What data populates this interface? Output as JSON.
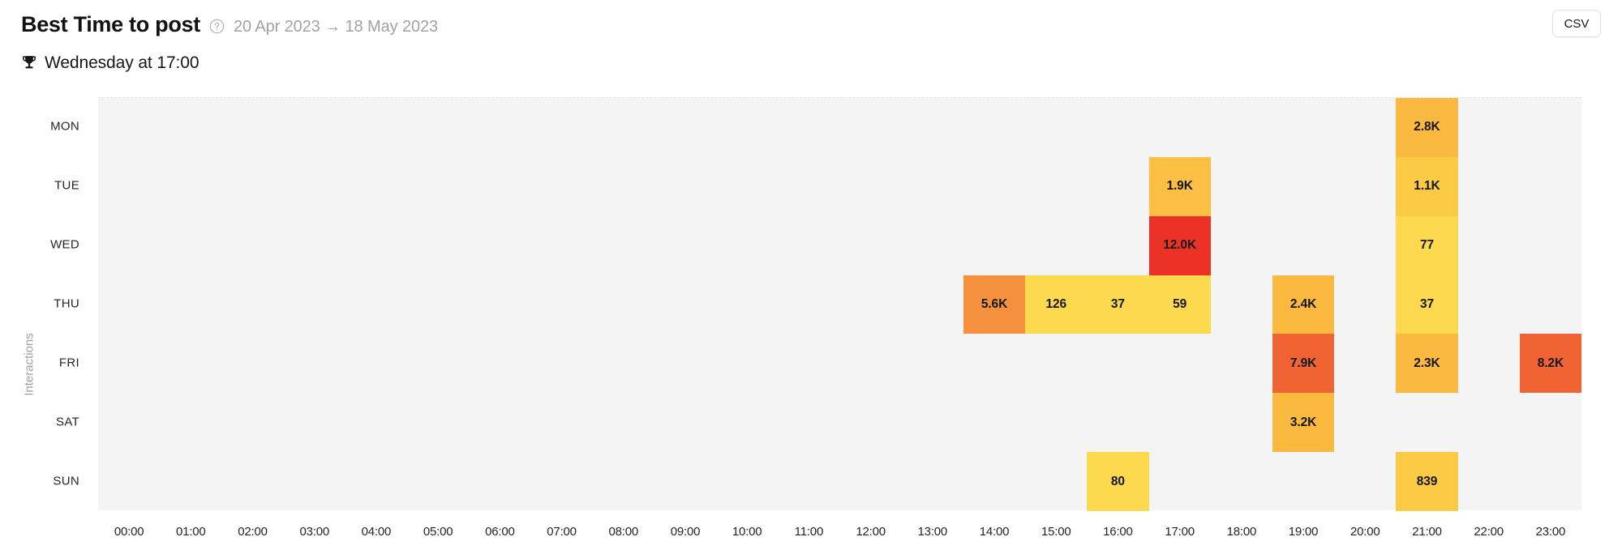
{
  "header": {
    "title": "Best Time to post",
    "help_icon": "help-circle-icon",
    "date_range": "20 Apr 2023 → 18 May 2023",
    "csv_label": "CSV"
  },
  "subtitle": {
    "trophy_icon": "trophy-icon",
    "text": "Wednesday at 17:00"
  },
  "chart_data": {
    "type": "heatmap",
    "title": "Best Time to post",
    "xlabel": "",
    "ylabel": "Interactions",
    "grid": false,
    "legend": "none",
    "x_tick_labels": [
      "00:00",
      "01:00",
      "02:00",
      "03:00",
      "04:00",
      "05:00",
      "06:00",
      "07:00",
      "08:00",
      "09:00",
      "10:00",
      "11:00",
      "12:00",
      "13:00",
      "14:00",
      "15:00",
      "16:00",
      "17:00",
      "18:00",
      "19:00",
      "20:00",
      "21:00",
      "22:00",
      "23:00"
    ],
    "y_tick_labels": [
      "MON",
      "TUE",
      "WED",
      "THU",
      "FRI",
      "SAT",
      "SUN"
    ],
    "colors": {
      "empty": "#f4f4f5",
      "pale_yellow": "#fcd94e",
      "yellow": "#fbcb46",
      "amber": "#fbb940",
      "orange": "#f4903e",
      "deep_orange": "#f06434",
      "red": "#ec3126"
    },
    "cells": [
      {
        "day": "MON",
        "hour": "21:00",
        "label": "2.8K",
        "value": 2800,
        "color": "#fbb940"
      },
      {
        "day": "TUE",
        "hour": "17:00",
        "label": "1.9K",
        "value": 1900,
        "color": "#fbbf44"
      },
      {
        "day": "TUE",
        "hour": "21:00",
        "label": "1.1K",
        "value": 1100,
        "color": "#fbcb46"
      },
      {
        "day": "WED",
        "hour": "17:00",
        "label": "12.0K",
        "value": 12000,
        "color": "#ec3126"
      },
      {
        "day": "WED",
        "hour": "21:00",
        "label": "77",
        "value": 77,
        "color": "#fcd94e"
      },
      {
        "day": "THU",
        "hour": "14:00",
        "label": "5.6K",
        "value": 5600,
        "color": "#f4903e"
      },
      {
        "day": "THU",
        "hour": "15:00",
        "label": "126",
        "value": 126,
        "color": "#fcd94e"
      },
      {
        "day": "THU",
        "hour": "16:00",
        "label": "37",
        "value": 37,
        "color": "#fcd94e"
      },
      {
        "day": "THU",
        "hour": "17:00",
        "label": "59",
        "value": 59,
        "color": "#fcd94e"
      },
      {
        "day": "THU",
        "hour": "19:00",
        "label": "2.4K",
        "value": 2400,
        "color": "#fbb940"
      },
      {
        "day": "THU",
        "hour": "21:00",
        "label": "37",
        "value": 37,
        "color": "#fcd94e"
      },
      {
        "day": "FRI",
        "hour": "19:00",
        "label": "7.9K",
        "value": 7900,
        "color": "#f06434"
      },
      {
        "day": "FRI",
        "hour": "21:00",
        "label": "2.3K",
        "value": 2300,
        "color": "#fbb940"
      },
      {
        "day": "FRI",
        "hour": "23:00",
        "label": "8.2K",
        "value": 8200,
        "color": "#f06434"
      },
      {
        "day": "SAT",
        "hour": "19:00",
        "label": "3.2K",
        "value": 3200,
        "color": "#fbb940"
      },
      {
        "day": "SUN",
        "hour": "16:00",
        "label": "80",
        "value": 80,
        "color": "#fcd94e"
      },
      {
        "day": "SUN",
        "hour": "21:00",
        "label": "839",
        "value": 839,
        "color": "#fbcb46"
      }
    ]
  }
}
